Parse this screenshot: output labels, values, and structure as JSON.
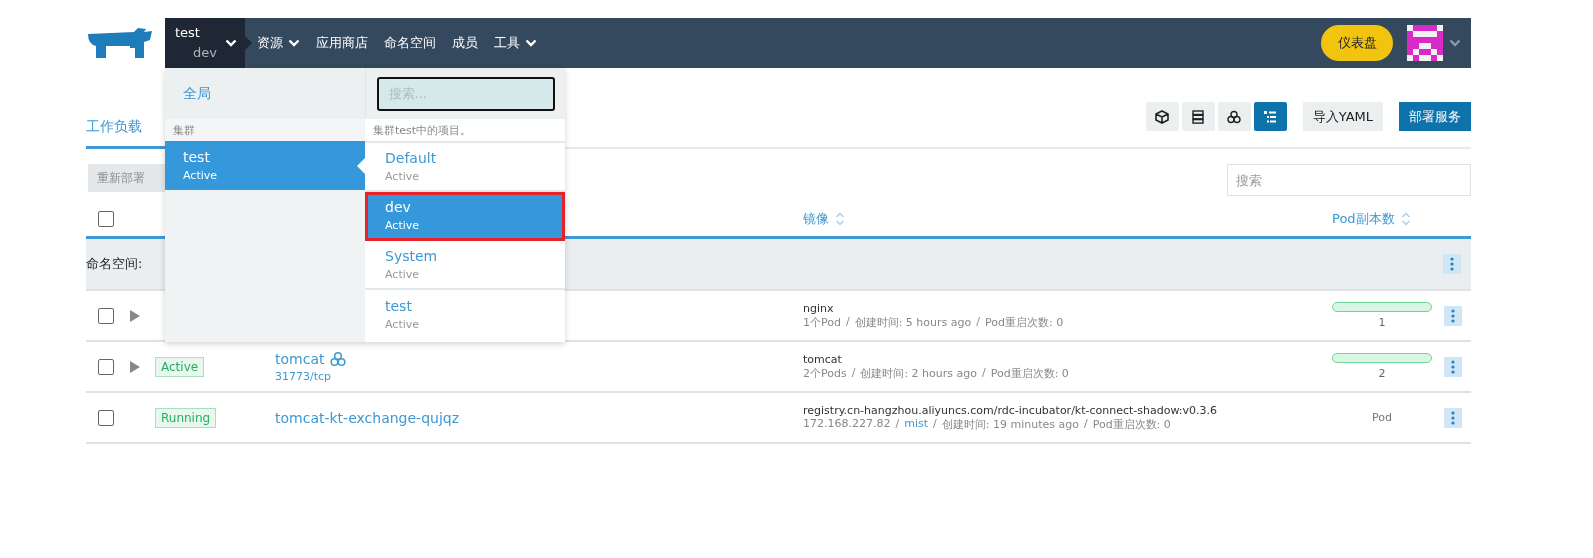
{
  "header": {
    "cluster": "test",
    "project": "dev",
    "nav": [
      {
        "label": "资源",
        "has_menu": true
      },
      {
        "label": "应用商店",
        "has_menu": false
      },
      {
        "label": "命名空间",
        "has_menu": false
      },
      {
        "label": "成员",
        "has_menu": false
      },
      {
        "label": "工具",
        "has_menu": true
      }
    ],
    "dashboard_button": "仪表盘"
  },
  "page": {
    "tabs": [
      {
        "label": "工作负载",
        "selected": true
      }
    ],
    "view_buttons": [
      {
        "kind": "node",
        "selected": false
      },
      {
        "kind": "list",
        "selected": false
      },
      {
        "kind": "group",
        "selected": false
      },
      {
        "kind": "tree",
        "selected": true
      }
    ],
    "import_button": "导入YAML",
    "deploy_button": "部署服务",
    "redeploy_button": "重新部署",
    "search": {
      "placeholder": "搜索"
    }
  },
  "table": {
    "select_all_checked": false,
    "columns": [
      {
        "label": "镜像",
        "sortable": true
      },
      {
        "label": "Pod副本数",
        "sortable": true
      }
    ],
    "group_label": "命名空间:",
    "detail_separator": "/",
    "rows": [
      {
        "checked": false,
        "expandable": true,
        "image": "nginx",
        "details": [
          {
            "text": "1个Pod",
            "link": false
          },
          {
            "text": "创建时间: 5 hours ago",
            "link": false
          },
          {
            "text": "Pod重启次数: 0",
            "link": false
          }
        ],
        "scale": {
          "kind": "bar",
          "level": 1,
          "count": "1"
        }
      },
      {
        "checked": false,
        "expandable": true,
        "status": "Active",
        "name": "tomcat",
        "name_icon": true,
        "endpoint": "31773/tcp",
        "image": "tomcat",
        "details": [
          {
            "text": "2个Pods",
            "link": false
          },
          {
            "text": "创建时间: 2 hours ago",
            "link": false
          },
          {
            "text": "Pod重启次数: 0",
            "link": false
          }
        ],
        "scale": {
          "kind": "bar",
          "level": 1,
          "count": "2"
        }
      },
      {
        "checked": false,
        "expandable": false,
        "status": "Running",
        "name": "tomcat-kt-exchange-qujqz",
        "name_icon": false,
        "image": "registry.cn-hangzhou.aliyuncs.com/rdc-incubator/kt-connect-shadow:v0.3.6",
        "details": [
          {
            "text": "172.168.227.82",
            "link": false
          },
          {
            "text": "mist",
            "link": true
          },
          {
            "text": "创建时间: 19 minutes ago",
            "link": false
          },
          {
            "text": "Pod重启次数: 0",
            "link": false
          }
        ],
        "scale": {
          "kind": "pod",
          "count": "Pod"
        }
      }
    ]
  },
  "dropdown": {
    "global": {
      "label": "全局",
      "selected": false
    },
    "cluster_heading": "集群",
    "clusters": [
      {
        "name": "test",
        "status": "Active",
        "selected": true
      }
    ],
    "search": {
      "placeholder": "搜索..."
    },
    "project_heading": "集群test中的项目。",
    "projects": [
      {
        "name": "Default",
        "status": "Active",
        "selected": false,
        "marked": false
      },
      {
        "name": "dev",
        "status": "Active",
        "selected": true,
        "marked": true
      },
      {
        "name": "System",
        "status": "Active",
        "selected": false,
        "marked": false
      },
      {
        "name": "test",
        "status": "Active",
        "selected": false,
        "marked": false
      }
    ]
  }
}
